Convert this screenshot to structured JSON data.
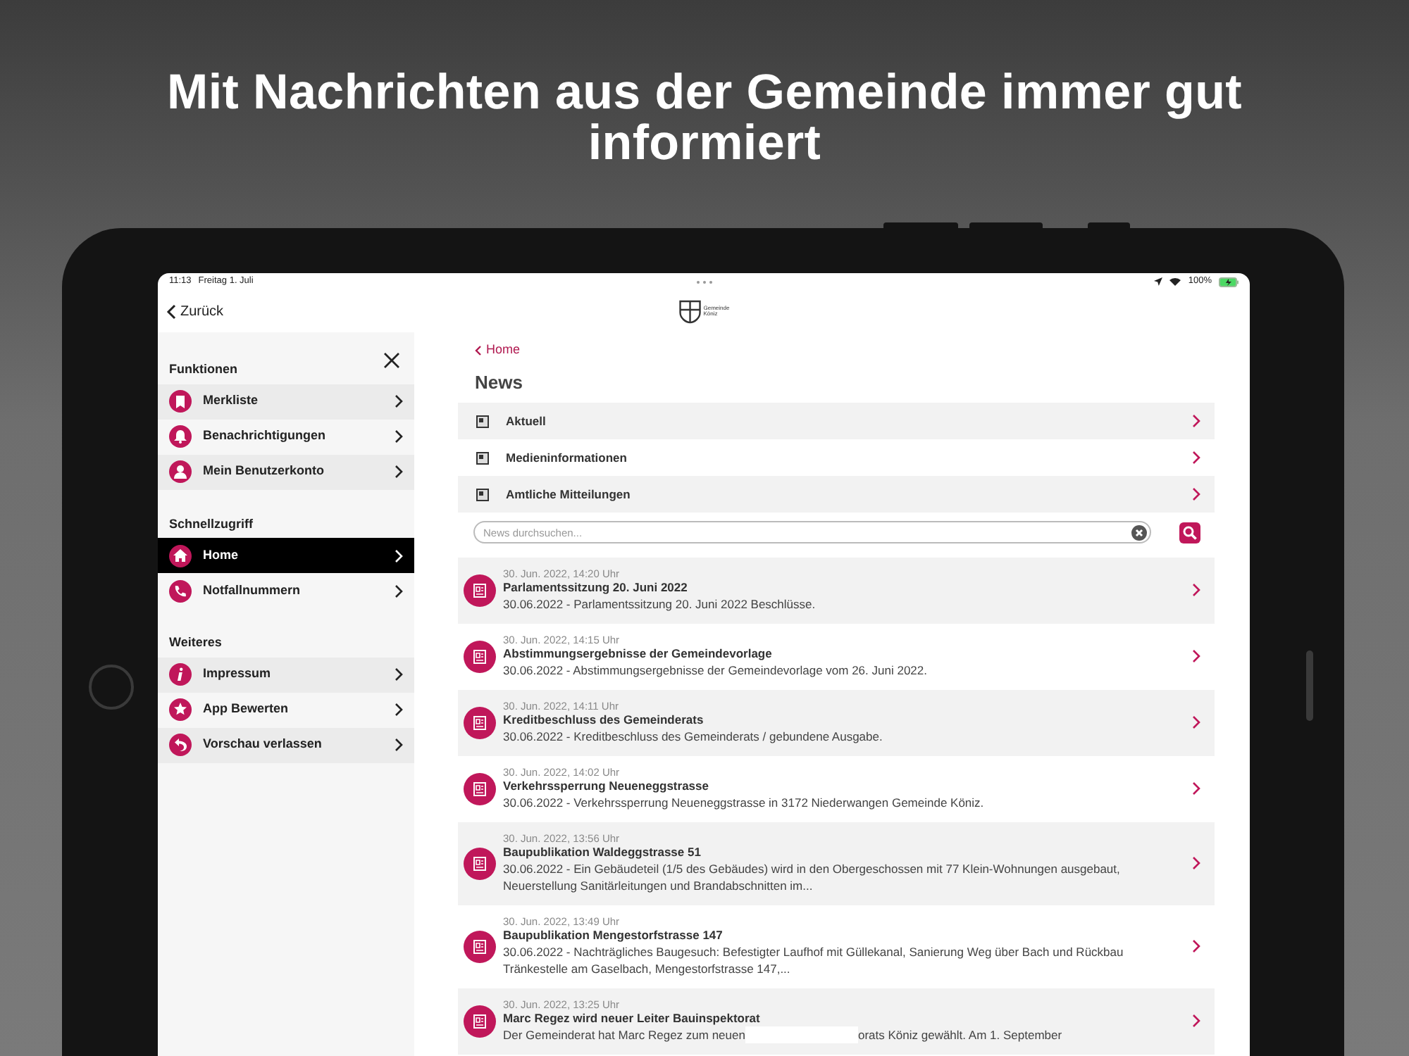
{
  "headline": "Mit Nachrichten aus der Gemeinde immer gut informiert",
  "status_bar": {
    "time": "11:13",
    "date": "Freitag 1. Juli",
    "battery": "100%"
  },
  "nav": {
    "back": "Zurück",
    "logo_text": [
      "Gemeinde",
      "Köniz"
    ]
  },
  "sidebar": {
    "sections": [
      {
        "title": "Funktionen",
        "items": [
          {
            "label": "Merkliste",
            "selected": false
          },
          {
            "label": "Benachrichtigungen",
            "selected": false
          },
          {
            "label": "Mein Benutzerkonto",
            "selected": false
          }
        ]
      },
      {
        "title": "Schnellzugriff",
        "items": [
          {
            "label": "Home",
            "selected": true
          },
          {
            "label": "Notfallnummern",
            "selected": false
          }
        ]
      },
      {
        "title": "Weiteres",
        "items": [
          {
            "label": "Impressum",
            "selected": false
          },
          {
            "label": "App Bewerten",
            "selected": false
          },
          {
            "label": "Vorschau verlassen",
            "selected": false
          }
        ]
      }
    ]
  },
  "breadcrumb": "Home",
  "page_title": "News",
  "categories": [
    "Aktuell",
    "Medieninformationen",
    "Amtliche Mitteilungen"
  ],
  "search": {
    "placeholder": "News durchsuchen..."
  },
  "news": [
    {
      "date": "30. Jun. 2022, 14:20 Uhr",
      "title": "Parlamentssitzung 20. Juni 2022",
      "summary": "30.06.2022 - Parlamentssitzung 20. Juni 2022 Beschlüsse."
    },
    {
      "date": "30. Jun. 2022, 14:15 Uhr",
      "title": "Abstimmungsergebnisse der Gemeindevorlage",
      "summary": "30.06.2022 - Abstimmungsergebnisse der Gemeindevorlage vom 26. Juni 2022."
    },
    {
      "date": "30. Jun. 2022, 14:11 Uhr",
      "title": "Kreditbeschluss des Gemeinderats",
      "summary": "30.06.2022 - Kreditbeschluss des Gemeinderats / gebundene Ausgabe."
    },
    {
      "date": "30. Jun. 2022, 14:02 Uhr",
      "title": "Verkehrssperrung Neueneggstrasse",
      "summary": "30.06.2022 - Verkehrssperrung Neueneggstrasse in 3172 Niederwangen Gemeinde Köniz."
    },
    {
      "date": "30. Jun. 2022, 13:56 Uhr",
      "title": "Baupublikation Waldeggstrasse 51",
      "summary": "30.06.2022 - Ein Gebäudeteil (1/5 des Gebäudes) wird in den Obergeschossen mit 77 Klein-Wohnungen ausgebaut, Neuerstellung Sanitärleitungen und Brandabschnitten im..."
    },
    {
      "date": "30. Jun. 2022, 13:49 Uhr",
      "title": "Baupublikation Mengestorfstrasse 147",
      "summary": "30.06.2022 - Nachträgliches Baugesuch: Befestigter Laufhof mit Güllekanal, Sanierung Weg über Bach und Rückbau Tränkestelle am Gaselbach, Mengestorfstrasse 147,..."
    },
    {
      "date": "30. Jun. 2022, 13:25 Uhr",
      "title": "Marc Regez wird neuer Leiter Bauinspektorat",
      "summary": "Der Gemeinderat hat Marc Regez zum neuen",
      "summary_after_overlay": "orats Köniz gewählt. Am 1. September"
    }
  ]
}
